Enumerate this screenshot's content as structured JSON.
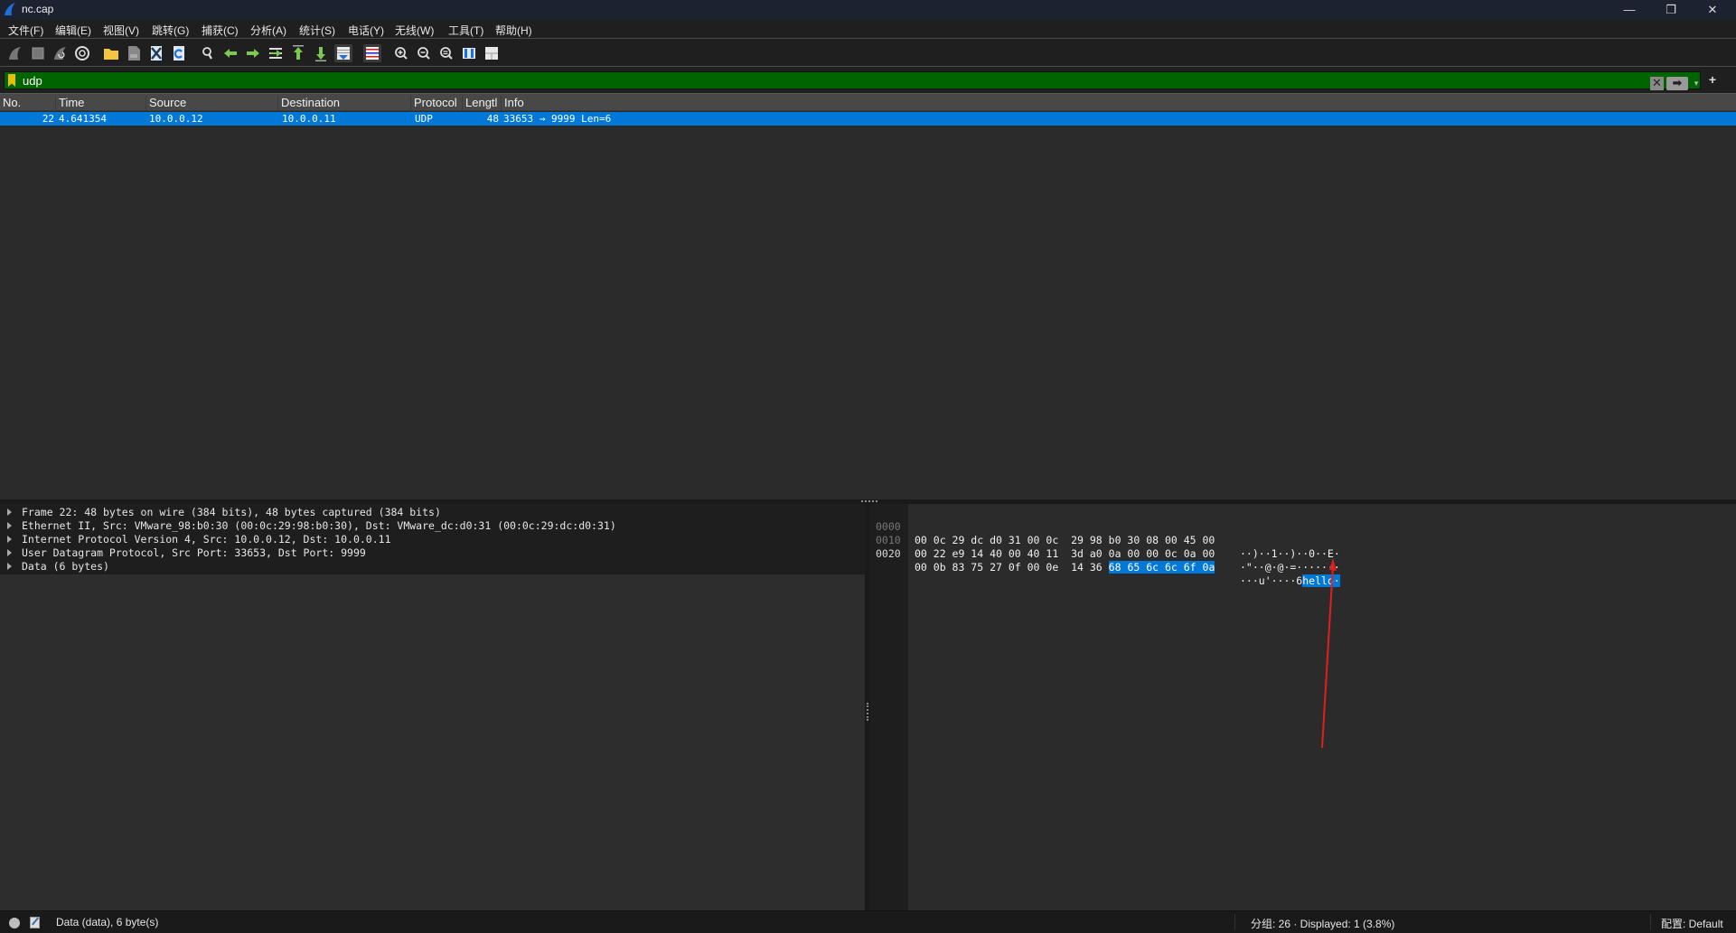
{
  "window": {
    "title": "nc.cap",
    "controls": {
      "minimize": "—",
      "restore": "❐",
      "close": "✕"
    }
  },
  "menu": [
    "文件(F)",
    "编辑(E)",
    "视图(V)",
    "跳转(G)",
    "捕获(C)",
    "分析(A)",
    "统计(S)",
    "电话(Y)",
    "无线(W)",
    "工具(T)",
    "帮助(H)"
  ],
  "toolbar": {
    "icons": [
      "start-capture-icon",
      "stop-capture-icon",
      "restart-capture-icon",
      "capture-options-icon",
      "open-file-icon",
      "save-file-icon",
      "close-file-icon",
      "reload-file-icon",
      "find-packet-icon",
      "go-back-icon",
      "go-forward-icon",
      "go-to-packet-icon",
      "first-packet-icon",
      "last-packet-icon",
      "auto-scroll-icon",
      "colorize-icon",
      "zoom-in-icon",
      "zoom-out-icon",
      "normal-size-icon",
      "resize-columns-icon",
      "layout-icon"
    ]
  },
  "filter": {
    "value": "udp",
    "clear_label": "✕",
    "apply_label": "➡",
    "dropdown_label": "▾",
    "add_label": "+",
    "valid_color": "#006400"
  },
  "packet_list": {
    "columns": [
      "No.",
      "Time",
      "Source",
      "Destination",
      "Protocol",
      "Lengtl",
      "Info"
    ],
    "rows": [
      {
        "no": "22",
        "time": "4.641354",
        "source": "10.0.0.12",
        "destination": "10.0.0.11",
        "protocol": "UDP",
        "length": "48",
        "info": "33653 → 9999 Len=6",
        "selected": true
      }
    ],
    "selected_color": "#0078d7"
  },
  "details": {
    "tree": [
      "Frame 22: 48 bytes on wire (384 bits), 48 bytes captured (384 bits)",
      "Ethernet II, Src: VMware_98:b0:30 (00:0c:29:98:b0:30), Dst: VMware_dc:d0:31 (00:0c:29:dc:d0:31)",
      "Internet Protocol Version 4, Src: 10.0.0.12, Dst: 10.0.0.11",
      "User Datagram Protocol, Src Port: 33653, Dst Port: 9999",
      "Data (6 bytes)"
    ]
  },
  "bytes": {
    "rows": [
      {
        "offset": "0000",
        "hex_a": "00 0c 29 dc d0 31 00 0c",
        "hex_b": "29 98 b0 30 08 00 45 00",
        "hex_hl": "",
        "ascii": "··)··1··)··0··E·",
        "ascii_hl": ""
      },
      {
        "offset": "0010",
        "hex_a": "00 22 e9 14 40 00 40 11",
        "hex_b": "3d a0 0a 00 00 0c 0a 00",
        "hex_hl": "",
        "ascii": "·\"··@·@·=·······",
        "ascii_hl": ""
      },
      {
        "offset": "0020",
        "hex_a": "00 0b 83 75 27 0f 00 0e",
        "hex_b": "14 36",
        "hex_hl": "68 65 6c 6c 6f 0a",
        "ascii": "···u'····6",
        "ascii_hl": "hello·"
      }
    ],
    "highlight_color": "#0078d7"
  },
  "annotation": {
    "arrow_color": "#e02020"
  },
  "status": {
    "field_info": "Data (data), 6 byte(s)",
    "packets": "分组: 26 · Displayed: 1 (3.8%)",
    "profile": "配置: Default"
  }
}
